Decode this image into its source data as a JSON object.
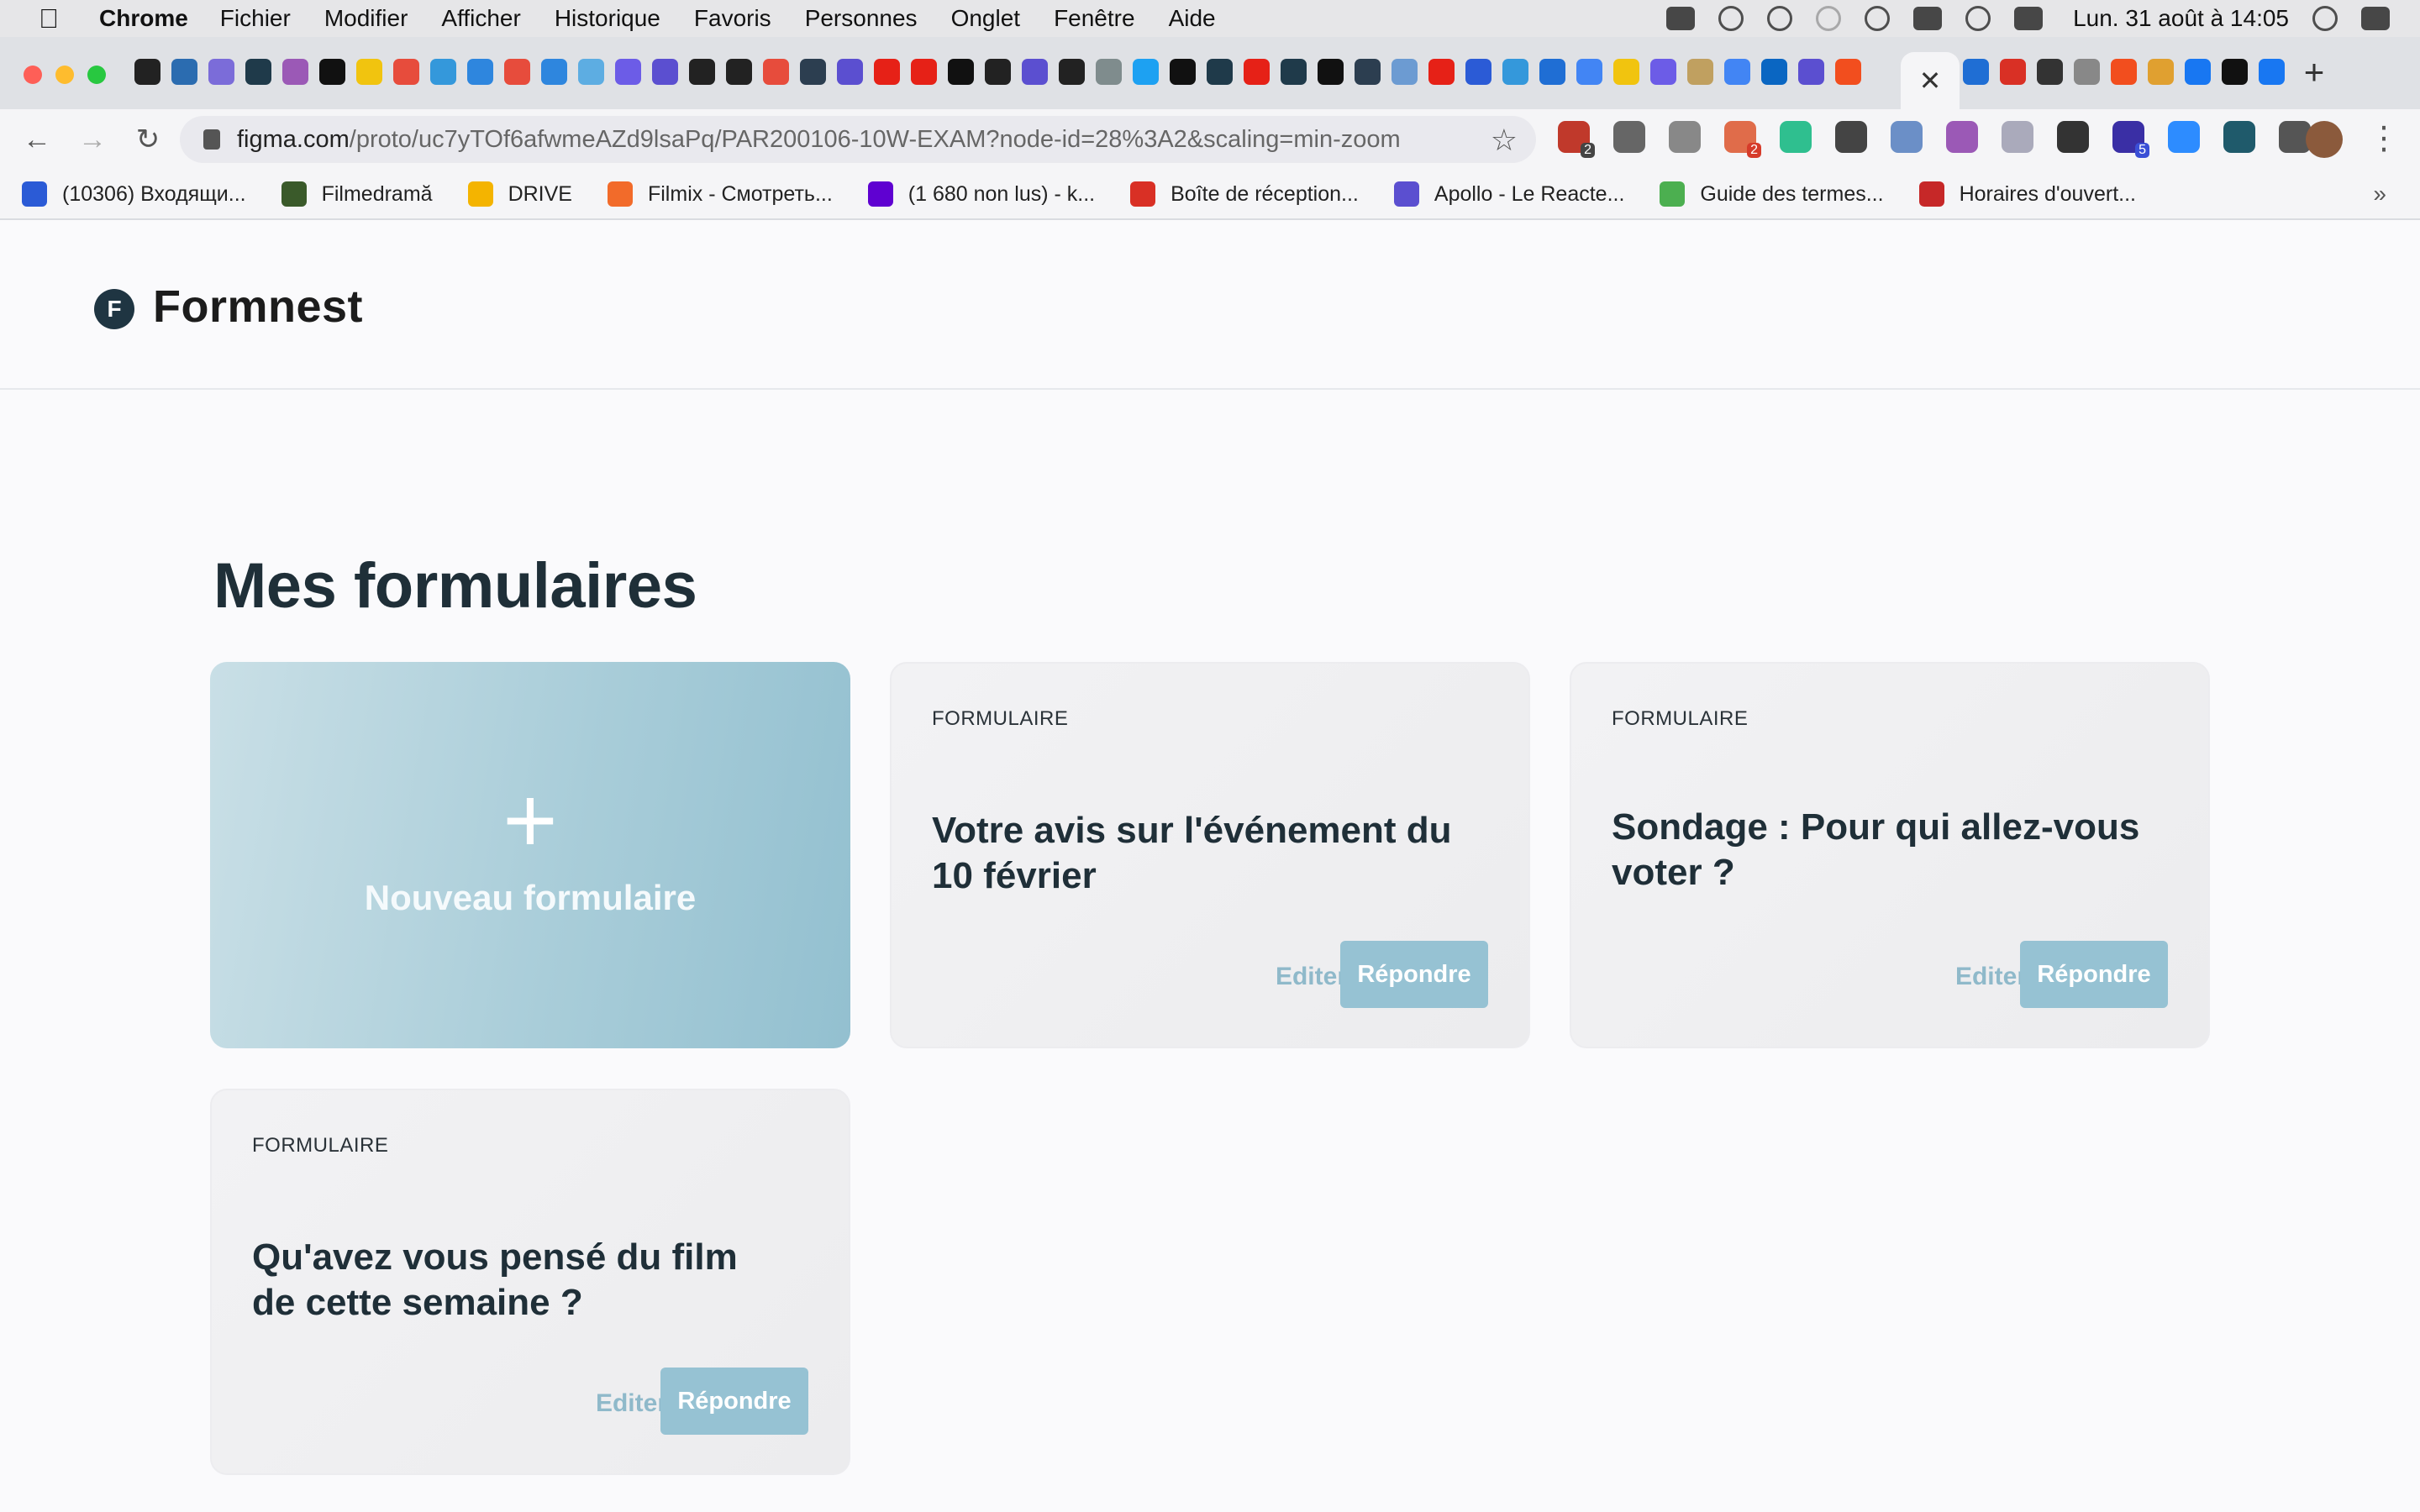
{
  "menubar": {
    "app_name": "Chrome",
    "menus": [
      "Fichier",
      "Modifier",
      "Afficher",
      "Historique",
      "Favoris",
      "Personnes",
      "Onglet",
      "Fenêtre",
      "Aide"
    ],
    "clock": "Lun. 31 août à 14:05"
  },
  "tabs": {
    "active_close_glyph": "✕",
    "new_tab_glyph": "+"
  },
  "toolbar": {
    "url_host": "figma.com",
    "url_path": "/proto/uc7yTOf6afwmeAZd9lsaPq/PAR200106-10W-EXAM?node-id=28%3A2&scaling=min-zoom",
    "ext_badges": {
      "abp": "2",
      "ext3": "2",
      "ext12": "5"
    }
  },
  "bookmarks": [
    {
      "label": "(10306) Входящи...",
      "color": "#2b5bd6"
    },
    {
      "label": "Filmedramă",
      "color": "#3a5a2a"
    },
    {
      "label": "DRIVE",
      "color": "#f4b400"
    },
    {
      "label": "Filmix - Смотреть...",
      "color": "#f26b2a"
    },
    {
      "label": "(1 680 non lus) - k...",
      "color": "#5f01d1"
    },
    {
      "label": "Boîte de réception...",
      "color": "#d93025"
    },
    {
      "label": "Apollo - Le Reacte...",
      "color": "#5b4fd0"
    },
    {
      "label": "Guide des termes...",
      "color": "#4caf50"
    },
    {
      "label": "Horaires d'ouvert...",
      "color": "#c62828"
    }
  ],
  "bookmarks_more": "»",
  "app": {
    "logo_letter": "F",
    "name": "Formnest",
    "page_title": "Mes formulaires",
    "new_form_label": "Nouveau formulaire",
    "forms": [
      {
        "kind": "FORMULAIRE",
        "title": "Votre avis sur l'événement du 10 février",
        "edit": "Editer",
        "reply": "Répondre"
      },
      {
        "kind": "FORMULAIRE",
        "title": "Sondage : Pour qui allez-vous voter ?",
        "edit": "Editer",
        "reply": "Répondre"
      },
      {
        "kind": "FORMULAIRE",
        "title": "Qu'avez vous pensé du film de cette semaine ?",
        "edit": "Editer",
        "reply": "Répondre"
      }
    ]
  },
  "colors": {
    "accent": "#96c2d3",
    "accent_text": "#8fb9ca",
    "heading": "#1f2f38"
  }
}
